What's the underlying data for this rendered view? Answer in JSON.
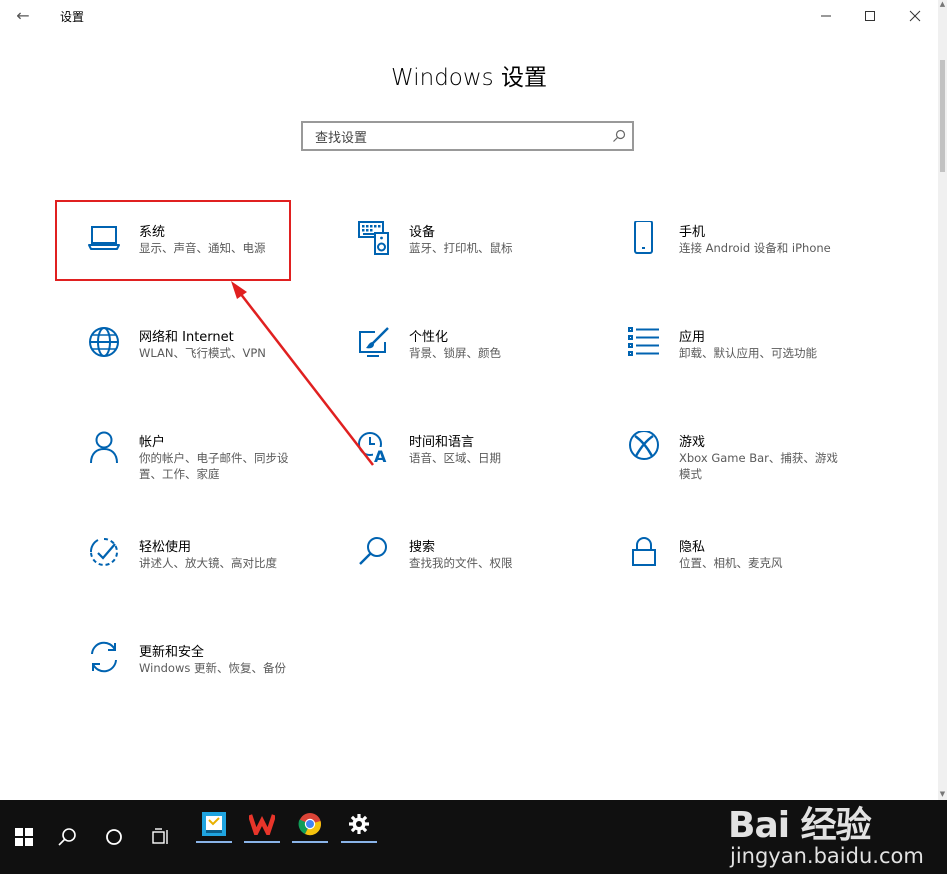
{
  "window": {
    "title": "设置",
    "back_label": "←"
  },
  "page": {
    "title": "Windows 设置"
  },
  "search": {
    "placeholder": "查找设置"
  },
  "tiles": [
    {
      "title": "系统",
      "desc": "显示、声音、通知、电源",
      "icon": "laptop-icon"
    },
    {
      "title": "设备",
      "desc": "蓝牙、打印机、鼠标",
      "icon": "keyboard-speaker-icon"
    },
    {
      "title": "手机",
      "desc": "连接 Android 设备和 iPhone",
      "icon": "phone-icon"
    },
    {
      "title": "网络和 Internet",
      "desc": "WLAN、飞行模式、VPN",
      "icon": "globe-icon"
    },
    {
      "title": "个性化",
      "desc": "背景、锁屏、颜色",
      "icon": "paint-brush-icon"
    },
    {
      "title": "应用",
      "desc": "卸载、默认应用、可选功能",
      "icon": "apps-list-icon"
    },
    {
      "title": "帐户",
      "desc": "你的帐户、电子邮件、同步设置、工作、家庭",
      "icon": "person-icon"
    },
    {
      "title": "时间和语言",
      "desc": "语音、区域、日期",
      "icon": "time-language-icon"
    },
    {
      "title": "游戏",
      "desc": "Xbox Game Bar、捕获、游戏模式",
      "icon": "xbox-icon"
    },
    {
      "title": "轻松使用",
      "desc": "讲述人、放大镜、高对比度",
      "icon": "ease-of-access-icon"
    },
    {
      "title": "搜索",
      "desc": "查找我的文件、权限",
      "icon": "magnifier-icon"
    },
    {
      "title": "隐私",
      "desc": "位置、相机、麦克风",
      "icon": "lock-icon"
    },
    {
      "title": "更新和安全",
      "desc": "Windows 更新、恢复、备份",
      "icon": "sync-icon"
    }
  ],
  "colors": {
    "accent": "#0063b1",
    "highlight": "#e02020",
    "taskbar": "#101010"
  },
  "taskbar": {
    "items": [
      "windows-start-icon",
      "search-icon",
      "task-view-icon",
      "timeline-icon"
    ],
    "apps": [
      "editor-app-icon",
      "wps-app-icon",
      "chrome-app-icon",
      "settings-app-icon"
    ]
  },
  "watermark": {
    "logo": "Bai 经验",
    "url": "jingyan.baidu.com"
  }
}
